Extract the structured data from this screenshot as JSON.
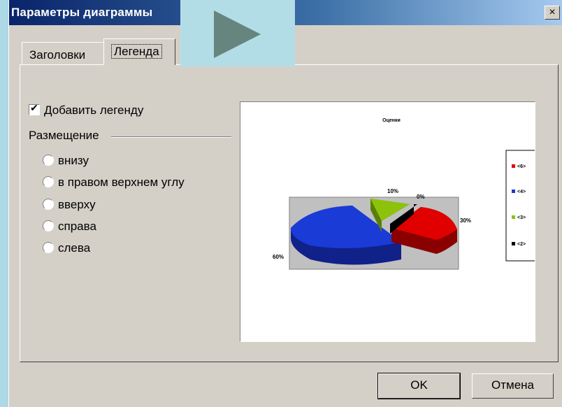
{
  "dialog": {
    "title": "Параметры диаграммы",
    "close_label": "×"
  },
  "tabs": [
    {
      "label": "Заголовки",
      "active": false
    },
    {
      "label": "Легенда",
      "active": true
    }
  ],
  "legend_options": {
    "add_legend_label": "Добавить легенду",
    "add_legend_checked": true,
    "placement_label": "Размещение",
    "placements": [
      {
        "label": "внизу",
        "selected": false
      },
      {
        "label": "в правом верхнем углу",
        "selected": false
      },
      {
        "label": "вверху",
        "selected": false
      },
      {
        "label": "справа",
        "selected": false
      },
      {
        "label": "слева",
        "selected": false
      }
    ]
  },
  "preview": {
    "chart_data": {
      "type": "pie",
      "title": "Оценки",
      "legend_position": "right",
      "slices": [
        {
          "label": "<6>",
          "percent_label": "30%",
          "color": "#e00000"
        },
        {
          "label": "<4>",
          "percent_label": "60%",
          "color": "#1a3bd6"
        },
        {
          "label": "<3>",
          "percent_label": "10%",
          "color": "#8cc30a"
        },
        {
          "label": "<2>",
          "percent_label": "0%",
          "color": "#000000"
        }
      ]
    }
  },
  "buttons": {
    "ok": "OK",
    "cancel": "Отмена"
  }
}
